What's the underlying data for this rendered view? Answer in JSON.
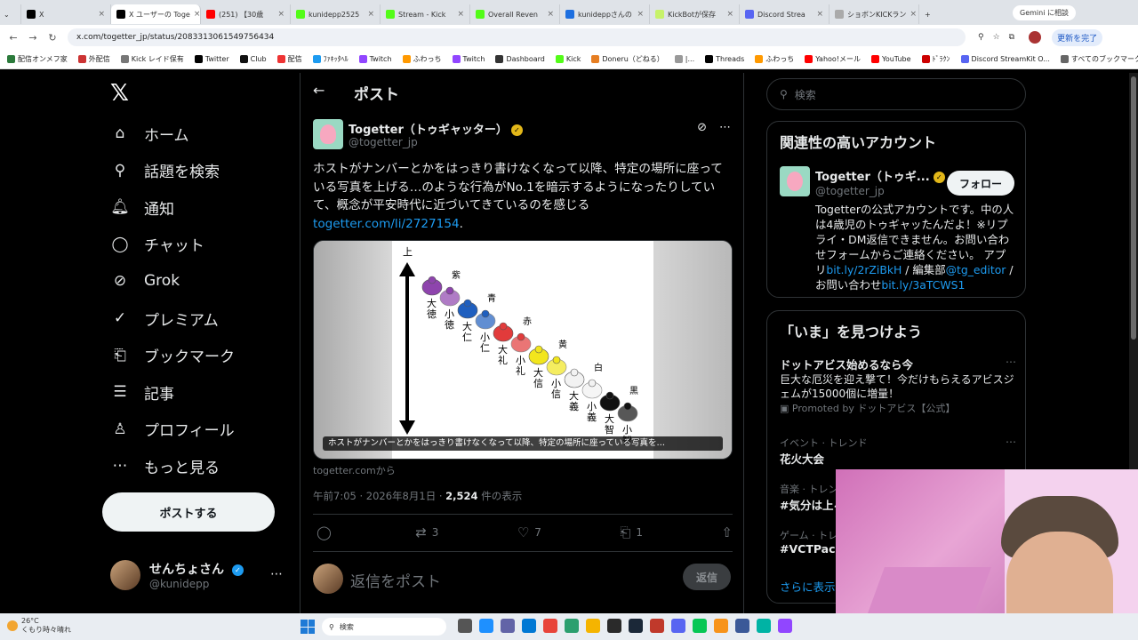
{
  "browser": {
    "tabs": [
      {
        "title": "X",
        "color": "#000000",
        "active": false
      },
      {
        "title": "X ユーザーの Toge",
        "color": "#000000",
        "active": true
      },
      {
        "title": "(251) 【30歳",
        "color": "#ff0000",
        "active": false
      },
      {
        "title": "kunidepp2525",
        "color": "#53fc18",
        "active": false
      },
      {
        "title": "Stream - Kick",
        "color": "#53fc18",
        "active": false
      },
      {
        "title": "Overall Reven",
        "color": "#53fc18",
        "active": false
      },
      {
        "title": "kunideppさんの",
        "color": "#1d6fe0",
        "active": false
      },
      {
        "title": "KickBotが保存",
        "color": "#c7f26a",
        "active": false
      },
      {
        "title": "Discord Strea",
        "color": "#5865f2",
        "active": false
      },
      {
        "title": "ショボンKICKラン",
        "color": "#aaaaaa",
        "active": false
      }
    ],
    "gemini": "Gemini に相談",
    "url": "x.com/togetter_jp/status/2083313061549756434",
    "update_label": "更新を完了",
    "bookmarks": [
      "配信オンメフ家",
      "外配信",
      "Kick レイド保有",
      "Twitter",
      "Club",
      "配信",
      "ﾌｧｷｯﾀﾍﾙ",
      "Twitch",
      "ふわっち",
      "Twitch",
      "Dashboard",
      "Kick",
      "Doneru（どねる）",
      "|...",
      "Threads",
      "ふわっち",
      "Yahoo!メール",
      "YouTube",
      "ﾄﾞﾗｸﾝ",
      "Discord StreamKit O...",
      "すべてのブックマーク"
    ]
  },
  "nav": {
    "logo": "𝕏",
    "items": [
      {
        "label": "ホーム",
        "icon": "⌂",
        "name": "home"
      },
      {
        "label": "話題を検索",
        "icon": "⚲",
        "name": "explore"
      },
      {
        "label": "通知",
        "icon": "🔔︎",
        "name": "notifications"
      },
      {
        "label": "チャット",
        "icon": "◯",
        "name": "chat"
      },
      {
        "label": "Grok",
        "icon": "⊘",
        "name": "grok"
      },
      {
        "label": "プレミアム",
        "icon": "✓",
        "name": "premium"
      },
      {
        "label": "ブックマーク",
        "icon": "⎗",
        "name": "bookmarks"
      },
      {
        "label": "記事",
        "icon": "☰",
        "name": "articles"
      },
      {
        "label": "プロフィール",
        "icon": "♙",
        "name": "profile"
      },
      {
        "label": "もっと見る",
        "icon": "⋯",
        "name": "more"
      }
    ],
    "post_button": "ポストする",
    "user": {
      "name": "せんちょさん",
      "handle": "@kunidepp"
    }
  },
  "main": {
    "title": "ポスト",
    "author": {
      "name": "Togetter（トゥギャッター）",
      "handle": "@togetter_jp"
    },
    "text": "ホストがナンバーとかをはっきり書けなくなって以降、特定の場所に座っている写真を上げる…のような行為がNo.1を暗示するようになったりしていて、概念が平安時代に近づいてきているのを感じる",
    "link": "togetter.com/li/2727154",
    "link_suffix": ".",
    "media_caption": "ホストがナンバーとかをはっきり書けなくなって以降、特定の場所に座っている写真を…",
    "source": "togetter.comから",
    "time": "午前7:05 · 2026年8月1日 · ",
    "views": "2,524",
    "views_label": " 件の表示",
    "actions": {
      "reply": "",
      "retweet": "3",
      "like": "7",
      "bookmark": "1"
    },
    "reply_placeholder": "返信をポスト",
    "reply_button": "返信",
    "diagram": {
      "top_label": "上",
      "ranks": [
        {
          "color_name": "紫",
          "hex": "#8e44ad",
          "ranks": [
            "大徳",
            "小徳"
          ]
        },
        {
          "color_name": "青",
          "hex": "#1f5fbf",
          "ranks": [
            "大仁",
            "小仁"
          ]
        },
        {
          "color_name": "赤",
          "hex": "#e23b3b",
          "ranks": [
            "大礼",
            "小礼"
          ]
        },
        {
          "color_name": "黄",
          "hex": "#f2e61d",
          "ranks": [
            "大信",
            "小信"
          ]
        },
        {
          "color_name": "白",
          "hex": "#f2f2f2",
          "ranks": [
            "大義",
            "小義"
          ]
        },
        {
          "color_name": "黒",
          "hex": "#111111",
          "ranks": [
            "大智",
            "小智"
          ]
        }
      ]
    }
  },
  "sidebar": {
    "search_placeholder": "検索",
    "related_title": "関連性の高いアカウント",
    "rec": {
      "name": "Togetter（トゥギ...",
      "handle": "@togetter_jp",
      "follow": "フォロー",
      "bio": "Togetterの公式アカウントです。中の人は4歳児のトゥギャッたんだよ！※リプライ・DM返信できません。お問い合わせフォームからご連絡ください。 アプリ",
      "link1": "bit.ly/2rZiBkH",
      "mid": " / 編集部",
      "link2": "@tg_editor",
      "mid2": " / お問い合わせ",
      "link3": "bit.ly/3aTCWS1"
    },
    "now_title": "「いま」を見つけよう",
    "trends": [
      {
        "meta": "",
        "title": "ドットアビス始めるなら今",
        "desc": "巨大な厄災を迎え撃て！今だけもらえるアビスジェムが15000個に増量！",
        "promo": "Promoted by ドットアビス【公式】"
      },
      {
        "meta": "イベント · トレンド",
        "title": "花火大会",
        "desc": "",
        "promo": ""
      },
      {
        "meta": "音楽 · トレンド",
        "title": "#気分は上々",
        "desc": "",
        "promo": ""
      },
      {
        "meta": "ゲーム · トレンド",
        "title": "#VCTPacific",
        "desc": "",
        "promo": ""
      }
    ],
    "show_more": "さらに表示"
  },
  "taskbar": {
    "weather_temp": "26°C",
    "weather_desc": "くもり時々晴れ",
    "search": "検索"
  }
}
